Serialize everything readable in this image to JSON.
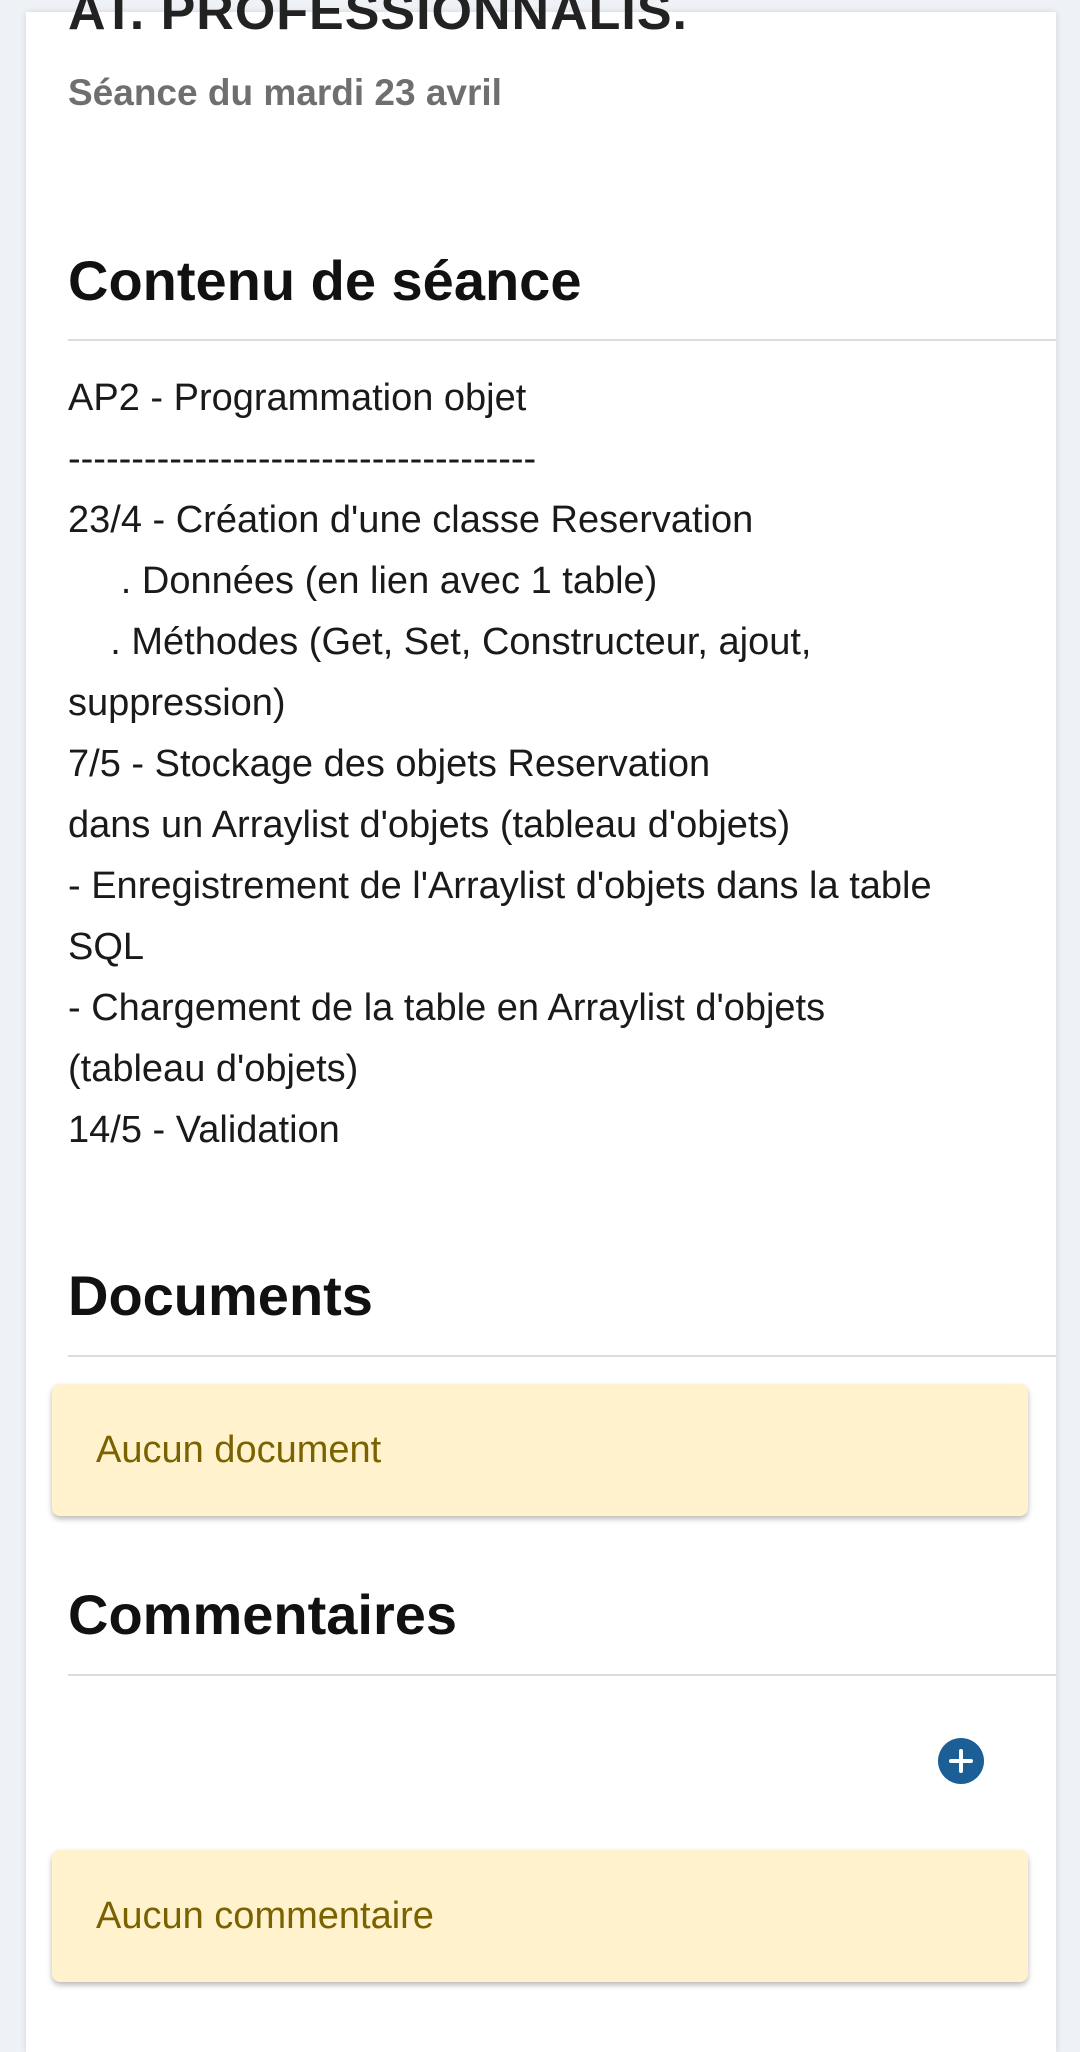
{
  "header": {
    "title": "AT. PROFESSIONNALIS.",
    "session_date": "Séance du mardi 23 avril"
  },
  "content_section": {
    "title": "Contenu de séance",
    "lines": [
      "AP2 - Programmation objet",
      "-------------------------------------",
      "23/4 - Création d'une classe Reservation",
      "     . Données (en lien avec 1 table)",
      "    . Méthodes (Get, Set, Constructeur, ajout,",
      "suppression)",
      "7/5 - Stockage des objets Reservation",
      "dans un Arraylist d'objets (tableau d'objets)",
      "- Enregistrement de l'Arraylist d'objets dans la table",
      "SQL",
      "- Chargement de la table en Arraylist d'objets",
      "(tableau d'objets)",
      "14/5 - Validation"
    ]
  },
  "documents_section": {
    "title": "Documents",
    "empty_message": "Aucun document"
  },
  "comments_section": {
    "title": "Commentaires",
    "add_icon": "plus-circle-icon",
    "empty_message": "Aucun commentaire"
  },
  "colors": {
    "alert_background": "#fff2cc",
    "alert_text": "#7a6200",
    "add_button": "#1c5e96"
  }
}
